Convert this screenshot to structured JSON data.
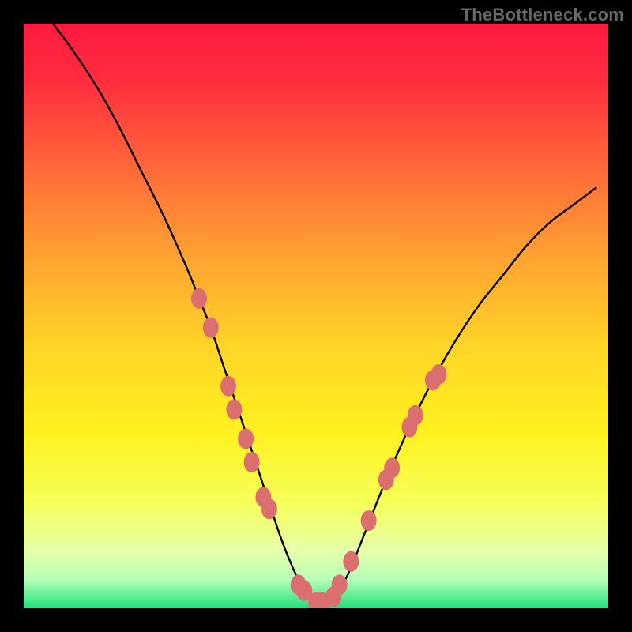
{
  "watermark": "TheBottleneck.com",
  "gradient_stops": [
    {
      "offset": 0.0,
      "color": "#ff1a3f"
    },
    {
      "offset": 0.1,
      "color": "#ff2e3f"
    },
    {
      "offset": 0.25,
      "color": "#ff6a3a"
    },
    {
      "offset": 0.4,
      "color": "#ffa332"
    },
    {
      "offset": 0.55,
      "color": "#ffd428"
    },
    {
      "offset": 0.7,
      "color": "#fff120"
    },
    {
      "offset": 0.82,
      "color": "#f6ff5a"
    },
    {
      "offset": 0.9,
      "color": "#e6ffa8"
    },
    {
      "offset": 0.95,
      "color": "#b9ffb9"
    },
    {
      "offset": 1.0,
      "color": "#20e07a"
    }
  ],
  "chart_data": {
    "type": "line",
    "title": "",
    "xlabel": "",
    "ylabel": "",
    "xlim": [
      0,
      100
    ],
    "ylim": [
      0,
      100
    ],
    "legend": false,
    "grid": false,
    "series": [
      {
        "name": "bottleneck-curve",
        "x": [
          5,
          8,
          12,
          16,
          20,
          24,
          28,
          30,
          32,
          34,
          36,
          38,
          40,
          42,
          44,
          46,
          48,
          50,
          52,
          54,
          56,
          58,
          62,
          66,
          70,
          74,
          78,
          82,
          86,
          90,
          94,
          98
        ],
        "y": [
          100,
          96,
          90,
          83,
          75,
          67,
          58,
          53,
          48,
          42,
          36,
          30,
          24,
          18,
          12,
          7,
          3,
          1,
          1,
          3,
          7,
          12,
          22,
          31,
          39,
          46,
          52,
          57,
          62,
          66,
          69,
          72
        ]
      }
    ],
    "markers": {
      "name": "highlight-dots",
      "color": "#db6f6f",
      "points": [
        {
          "x": 30,
          "y": 53
        },
        {
          "x": 32,
          "y": 48
        },
        {
          "x": 35,
          "y": 38
        },
        {
          "x": 36,
          "y": 34
        },
        {
          "x": 38,
          "y": 29
        },
        {
          "x": 39,
          "y": 25
        },
        {
          "x": 41,
          "y": 19
        },
        {
          "x": 42,
          "y": 17
        },
        {
          "x": 47,
          "y": 4
        },
        {
          "x": 48,
          "y": 3
        },
        {
          "x": 50,
          "y": 1
        },
        {
          "x": 51,
          "y": 1
        },
        {
          "x": 53,
          "y": 2
        },
        {
          "x": 54,
          "y": 4
        },
        {
          "x": 56,
          "y": 8
        },
        {
          "x": 59,
          "y": 15
        },
        {
          "x": 62,
          "y": 22
        },
        {
          "x": 63,
          "y": 24
        },
        {
          "x": 66,
          "y": 31
        },
        {
          "x": 67,
          "y": 33
        },
        {
          "x": 70,
          "y": 39
        },
        {
          "x": 71,
          "y": 40
        }
      ]
    }
  }
}
